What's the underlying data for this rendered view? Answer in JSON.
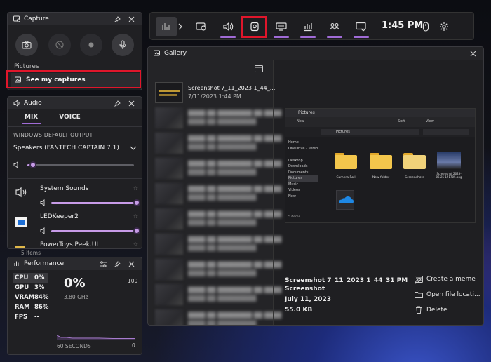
{
  "toolbar": {
    "clock": "1:45 PM"
  },
  "capture": {
    "title": "Capture",
    "pictures_label": "Pictures",
    "see_captures": "See my captures",
    "pictures_chip": "Pictures"
  },
  "audio": {
    "title": "Audio",
    "tabs": [
      "MIX",
      "VOICE"
    ],
    "output_label": "WINDOWS DEFAULT OUTPUT",
    "device": "Speakers (FANTECH CAPTAIN 7.1)",
    "master_level": 0.05,
    "apps": [
      {
        "name": "System Sounds",
        "level": 1.0
      },
      {
        "name": "LEDKeeper2",
        "level": 1.0
      },
      {
        "name": "PowerToys.Peek.UI",
        "level": 1.0
      }
    ],
    "items_count": "5 items"
  },
  "performance": {
    "title": "Performance",
    "metrics": [
      {
        "key": "CPU",
        "value": "0%"
      },
      {
        "key": "GPU",
        "value": "3%"
      },
      {
        "key": "VRAM",
        "value": "84%"
      },
      {
        "key": "RAM",
        "value": "86%"
      },
      {
        "key": "FPS",
        "value": "--"
      }
    ],
    "big_value": "0%",
    "ghz": "3.80 GHz",
    "max": "100",
    "seconds": "60 SECONDS",
    "min": "0"
  },
  "gallery": {
    "title": "Gallery",
    "selected_item": {
      "name": "Screenshot 7_11_2023 1_44_...",
      "date": "7/11/2023 1:44 PM"
    },
    "preview": {
      "window_title": "Pictures",
      "address": "Pictures",
      "sidebar": [
        "Home",
        "OneDrive - Perso",
        "Desktop",
        "Downloads",
        "Documents",
        "Pictures",
        "Music",
        "Videos",
        "New"
      ],
      "folders": [
        "Camera Roll",
        "New folder",
        "Screenshots"
      ],
      "file": "Screenshot 2023-06-25 151705.png",
      "status": "5 items",
      "toolbar": [
        "New",
        "Sort",
        "View"
      ]
    },
    "details": {
      "file_name": "Screenshot 7_11_2023 1_44_31 PM",
      "type": "Screenshot",
      "date": "July 11, 2023",
      "size": "55.0 KB"
    },
    "actions": {
      "meme": "Create a meme",
      "open": "Open file locati...",
      "delete": "Delete"
    }
  }
}
